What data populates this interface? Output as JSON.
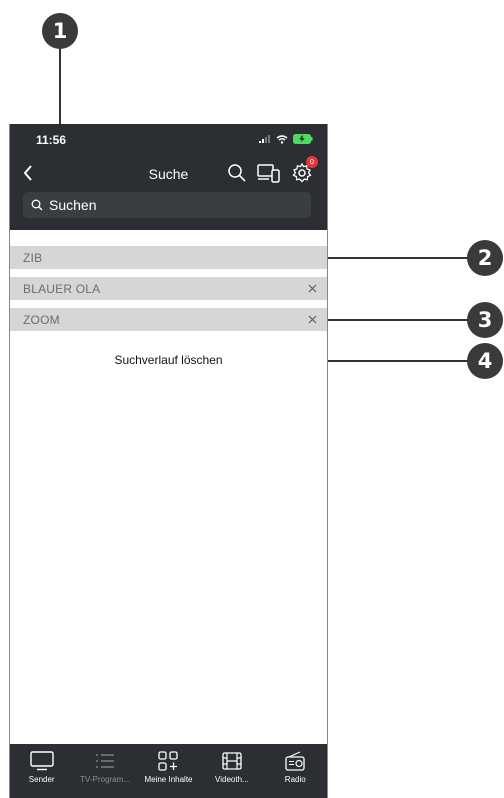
{
  "callouts": [
    "1",
    "2",
    "3",
    "4"
  ],
  "status": {
    "time": "11:56"
  },
  "header": {
    "title": "Suche",
    "notification_count": "0"
  },
  "search": {
    "placeholder": "Suchen",
    "value": ""
  },
  "history": [
    {
      "label": "ZIB",
      "removable": false
    },
    {
      "label": "BLAUER OLA",
      "removable": true
    },
    {
      "label": "ZOOM",
      "removable": true
    }
  ],
  "clear_history": "Suchverlauf löschen",
  "tabs": [
    {
      "label": "Sender",
      "icon": "tv-icon",
      "active": true
    },
    {
      "label": "TV-Program...",
      "icon": "list-icon",
      "active": false
    },
    {
      "label": "Meine Inhalte",
      "icon": "grid-plus-icon",
      "active": true
    },
    {
      "label": "Videoth...",
      "icon": "film-icon",
      "active": true
    },
    {
      "label": "Radio",
      "icon": "radio-icon",
      "active": true
    }
  ],
  "colors": {
    "bar": "#2b2e33",
    "item_bg": "#d6d6d6",
    "badge": "#e0383e",
    "battery": "#4cd964"
  }
}
